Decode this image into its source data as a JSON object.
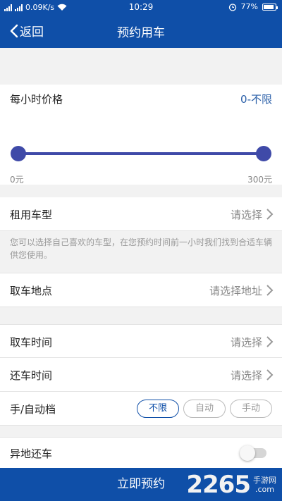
{
  "status_bar": {
    "network_speed": "0.09K/s",
    "time": "10:29",
    "battery": "77%"
  },
  "nav": {
    "back_label": "返回",
    "title": "预约用车"
  },
  "price": {
    "title": "每小时价格",
    "range": "0-不限",
    "min_label": "0元",
    "max_label": "300元",
    "slider_min_value": 0,
    "slider_max_value": 300
  },
  "vehicle_type": {
    "label": "租用车型",
    "value": "请选择",
    "hint": "您可以选择自己喜欢的车型，在您预约时间前一小时我们找到合适车辆供您使用。"
  },
  "pickup_location": {
    "label": "取车地点",
    "value": "请选择地址"
  },
  "pickup_time": {
    "label": "取车时间",
    "value": "请选择"
  },
  "return_time": {
    "label": "还车时间",
    "value": "请选择"
  },
  "transmission": {
    "label": "手/自动档",
    "options": [
      "不限",
      "自动",
      "手动"
    ],
    "selected": "不限"
  },
  "remote_return": {
    "label": "异地还车",
    "enabled": false
  },
  "submit": {
    "label": "立即预约"
  },
  "watermark": {
    "number": "2265",
    "suffix_line1": "手游网",
    "suffix_line2": ".com"
  },
  "colors": {
    "primary": "#0f4fa8",
    "slider": "#3f4aa8",
    "background": "#f2f2f2"
  }
}
